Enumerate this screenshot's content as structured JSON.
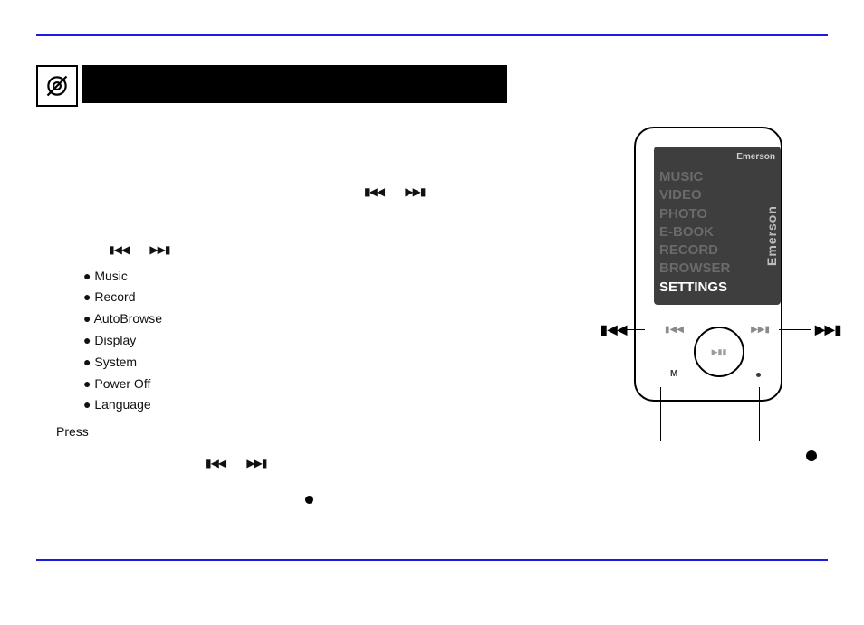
{
  "settings_options": [
    "Music",
    "Record",
    "AutoBrowse",
    "Display",
    "System",
    "Power Off",
    "Language"
  ],
  "press_label": "Press",
  "device_menu": [
    "MUSIC",
    "VIDEO",
    "PHOTO",
    "E-BOOK",
    "RECORD",
    "BROWSER",
    "SETTINGS"
  ],
  "device_brand_top": "Emerson",
  "device_brand_side": "Emerson"
}
